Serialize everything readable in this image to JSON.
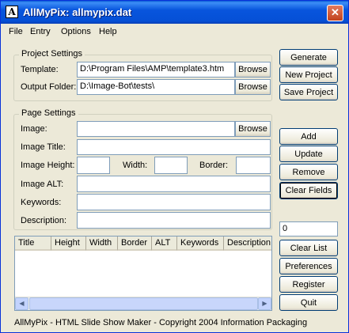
{
  "window": {
    "title": "AllMyPix: allmypix.dat",
    "icon_letter": "A",
    "close_glyph": "✕"
  },
  "menu": [
    "File",
    "Entry",
    "Options",
    "Help"
  ],
  "project_settings": {
    "legend": "Project Settings",
    "template_label": "Template:",
    "template_value": "D:\\Program Files\\AMP\\template3.htm",
    "output_label": "Output Folder:",
    "output_value": "D:\\Image-Bot\\tests\\",
    "browse_label": "Browse"
  },
  "page_settings": {
    "legend": "Page Settings",
    "image_label": "Image:",
    "image_value": "",
    "browse_label": "Browse",
    "title_label": "Image Title:",
    "title_value": "",
    "height_label": "Image Height:",
    "height_value": "",
    "width_label": "Width:",
    "width_value": "",
    "border_label": "Border:",
    "border_value": "",
    "alt_label": "Image ALT:",
    "alt_value": "",
    "keywords_label": "Keywords:",
    "keywords_value": "",
    "description_label": "Description:",
    "description_value": ""
  },
  "right_buttons_top": [
    "Generate",
    "New Project",
    "Save Project"
  ],
  "right_buttons_mid": [
    "Add",
    "Update",
    "Remove",
    "Clear Fields"
  ],
  "counter_value": "0",
  "right_buttons_bottom": [
    "Clear List",
    "Preferences",
    "Register",
    "Quit"
  ],
  "list": {
    "columns": [
      "Title",
      "Height",
      "Width",
      "Border",
      "ALT",
      "Keywords",
      "Description"
    ]
  },
  "status_text": "AllMyPix - HTML Slide Show Maker - Copyright 2004 Information Packaging"
}
